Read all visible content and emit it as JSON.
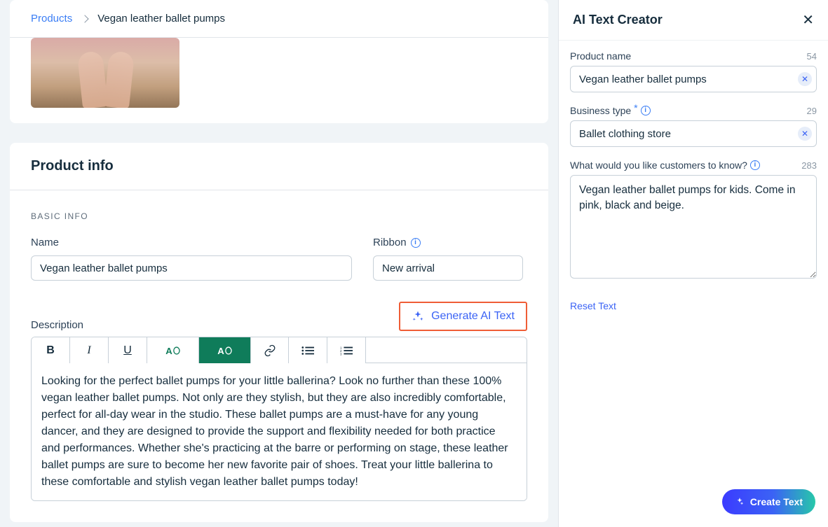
{
  "breadcrumb": {
    "root": "Products",
    "current": "Vegan leather ballet pumps"
  },
  "productInfo": {
    "cardTitle": "Product info",
    "sectionLabel": "BASIC INFO",
    "nameLabel": "Name",
    "nameValue": "Vegan leather ballet pumps",
    "ribbonLabel": "Ribbon",
    "ribbonValue": "New arrival",
    "descriptionLabel": "Description",
    "generateButton": "Generate AI Text",
    "descriptionValue": "Looking for the perfect ballet pumps for your little ballerina? Look no further than these 100% vegan leather ballet pumps. Not only are they stylish, but they are also incredibly comfortable, perfect for all-day wear in the studio. These ballet pumps are a must-have for any young dancer, and they are designed to provide the support and flexibility needed for both practice and performances. Whether she's practicing at the barre or performing on stage, these leather ballet pumps are sure to become her new favorite pair of shoes. Treat your little ballerina to these comfortable and stylish vegan leather ballet pumps today!"
  },
  "toolbar": {
    "bold": "B",
    "italic": "I",
    "underline": "U",
    "textColor": "A",
    "highlight": "A",
    "link": "link",
    "bulletList": "ul",
    "numberList": "ol"
  },
  "aiPanel": {
    "title": "AI Text Creator",
    "productNameLabel": "Product name",
    "productNameCount": "54",
    "productNameValue": "Vegan leather ballet pumps",
    "businessTypeLabel": "Business type",
    "businessTypeCount": "29",
    "businessTypeValue": "Ballet clothing store",
    "customersKnowLabel": "What would you like customers to know?",
    "customersKnowCount": "283",
    "customersKnowValue": "Vegan leather ballet pumps for kids. Come in pink, black and beige.",
    "resetText": "Reset Text",
    "createText": "Create Text"
  }
}
